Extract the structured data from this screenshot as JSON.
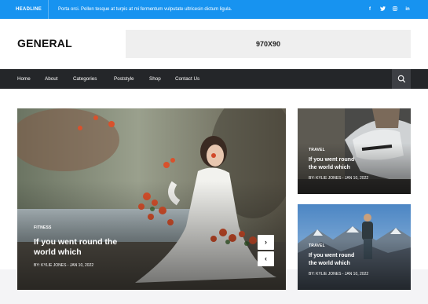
{
  "topbar": {
    "tag": "HEADLINE",
    "ticker": "Porta orci. Pellen tesque at turpis at mi fermentum vulputate ultricesin dictum ligula.",
    "social": [
      "f",
      "t",
      "in",
      "in"
    ],
    "social_icons": [
      "facebook-icon",
      "twitter-icon",
      "instagram-icon",
      "linkedin-icon"
    ]
  },
  "header": {
    "logo": "GENERAL",
    "ad": "970X90"
  },
  "nav": {
    "items": [
      "Home",
      "About",
      "Categories",
      "Poststyle",
      "Shop",
      "Contact Us"
    ]
  },
  "featured": {
    "category": "FITNESS",
    "title_line1": "If you went round the",
    "title_line2": "world which",
    "meta": "BY: KYLIE JONES - JAN 10, 2022",
    "next": "›",
    "prev": "‹"
  },
  "side_cards": [
    {
      "category": "TRAVEL",
      "title_line1": "If you went round",
      "title_line2": "the world which",
      "meta": "BY: KYLIE JONES - JAN 10, 2022"
    },
    {
      "category": "TRAVEL",
      "title_line1": "If you went round",
      "title_line2": "the world which",
      "meta": "BY: KYLIE JONES - JAN 10, 2022"
    }
  ],
  "colors": {
    "accent": "#1793f0",
    "nav": "#242629"
  }
}
